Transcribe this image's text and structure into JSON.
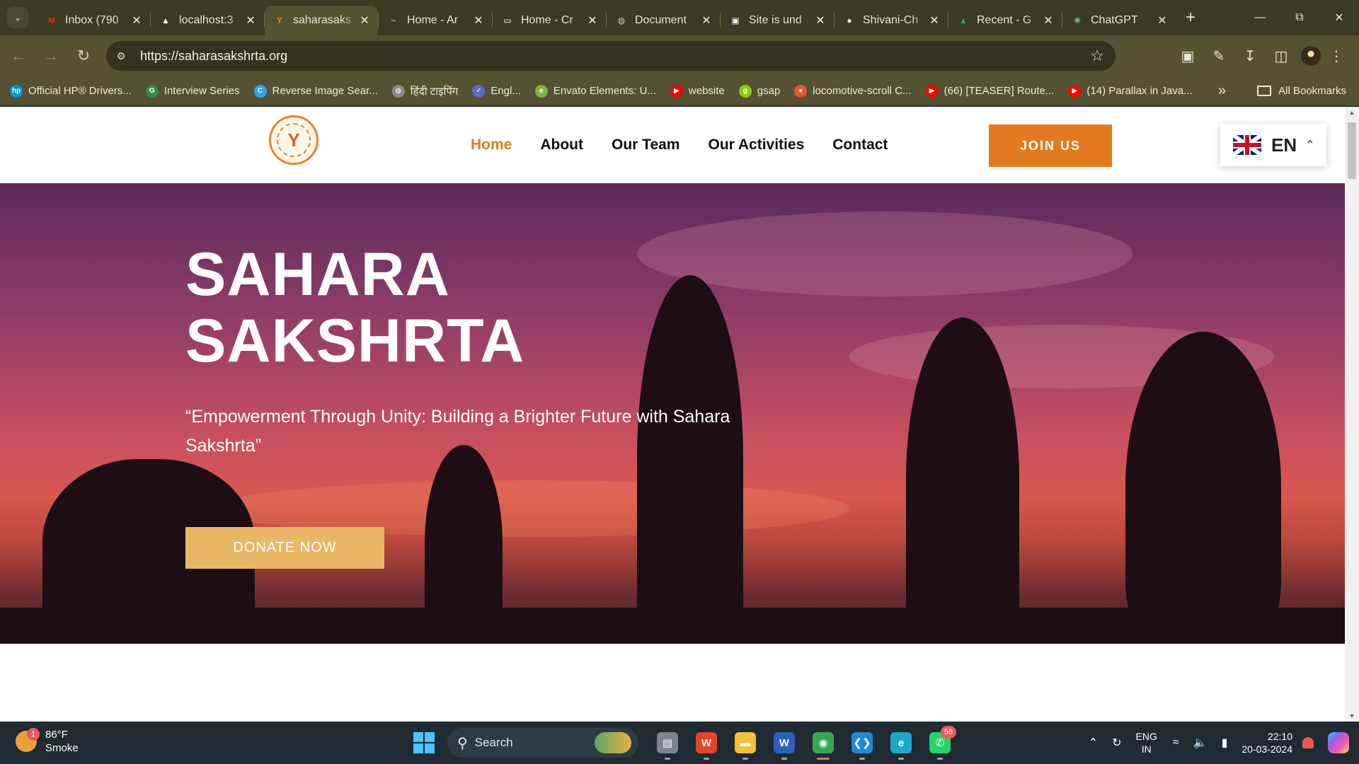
{
  "browser": {
    "tabs": [
      {
        "label": "Inbox (790",
        "icon": "gmail-icon",
        "color": "#d93025",
        "glyph": "M",
        "active": false
      },
      {
        "label": "localhost:3",
        "icon": "vercel-icon",
        "color": "#ffffff",
        "glyph": "▲",
        "active": false
      },
      {
        "label": "saharasaks",
        "icon": "sahara-logo-icon",
        "color": "#e8842a",
        "glyph": "Y",
        "active": true
      },
      {
        "label": "Home - Ar",
        "icon": "site-icon",
        "color": "#bdb9a6",
        "glyph": "~",
        "active": false
      },
      {
        "label": "Home - Cr",
        "icon": "doc-icon",
        "color": "#ffffff",
        "glyph": "▭",
        "active": false
      },
      {
        "label": "Document",
        "icon": "globe-icon",
        "color": "#c9c7b7",
        "glyph": "◍",
        "active": false
      },
      {
        "label": "Site is und",
        "icon": "page-icon",
        "color": "#ffffff",
        "glyph": "▣",
        "active": false
      },
      {
        "label": "Shivani-Ch",
        "icon": "github-icon",
        "color": "#ffffff",
        "glyph": "●",
        "active": false
      },
      {
        "label": "Recent - G",
        "icon": "google-drive-icon",
        "color": "#34a853",
        "glyph": "▲",
        "active": false
      },
      {
        "label": "ChatGPT",
        "icon": "chatgpt-icon",
        "color": "#74aa9c",
        "glyph": "✺",
        "active": false
      }
    ],
    "url": "https://saharasakshrta.org",
    "bookmarks": [
      {
        "label": "Official HP® Drivers...",
        "icon": "hp-icon",
        "color": "#0096d6",
        "glyph": "hp"
      },
      {
        "label": "Interview Series",
        "icon": "gfg-icon",
        "color": "#2f8d46",
        "glyph": "G"
      },
      {
        "label": "Reverse Image Sear...",
        "icon": "reverse-image-icon",
        "color": "#2ea3f2",
        "glyph": "C"
      },
      {
        "label": "हिंदी टाइपिंग",
        "icon": "hindi-typing-icon",
        "color": "#8a8a8a",
        "glyph": "◍"
      },
      {
        "label": "Engl...",
        "icon": "check-icon",
        "color": "#5c6bc0",
        "glyph": "✓"
      },
      {
        "label": "Envato Elements: U...",
        "icon": "envato-icon",
        "color": "#82b541",
        "glyph": "e"
      },
      {
        "label": "website",
        "icon": "youtube-icon",
        "color": "#ff0000",
        "glyph": "▶"
      },
      {
        "label": "gsap",
        "icon": "gsap-icon",
        "color": "#88ce02",
        "glyph": "g"
      },
      {
        "label": "locomotive-scroll C...",
        "icon": "locomotive-icon",
        "color": "#e4572e",
        "glyph": "●"
      },
      {
        "label": "(66) [TEASER] Route...",
        "icon": "youtube-icon",
        "color": "#ff0000",
        "glyph": "▶"
      },
      {
        "label": "(14) Parallax in Java...",
        "icon": "youtube-icon",
        "color": "#ff0000",
        "glyph": "▶"
      }
    ],
    "all_bookmarks_label": "All Bookmarks"
  },
  "site": {
    "nav": [
      "Home",
      "About",
      "Our Team",
      "Our Activities",
      "Contact"
    ],
    "join_label": "JOIN US",
    "language": "EN",
    "hero": {
      "title_line1": "SAHARA",
      "title_line2": "SAKSHRTA",
      "subtitle": "“Empowerment Through Unity: Building a Brighter Future with Sahara Sakshrta”",
      "donate_label": "DONATE NOW"
    },
    "colors": {
      "accent": "#e47a20",
      "donate": "#e7b765",
      "nav_active": "#e07a22"
    }
  },
  "taskbar": {
    "weather": {
      "temp": "86°F",
      "condition": "Smoke",
      "badge": "1"
    },
    "search_label": "Search",
    "apps": [
      {
        "name": "file-stack-icon",
        "color": "#7a8590",
        "glyph": "▤"
      },
      {
        "name": "wps-office-icon",
        "color": "#e8412c",
        "glyph": "W"
      },
      {
        "name": "file-explorer-icon",
        "color": "#f3c13a",
        "glyph": "▬"
      },
      {
        "name": "word-icon",
        "color": "#2b5fb9",
        "glyph": "W"
      },
      {
        "name": "chrome-icon",
        "color": "#34a853",
        "glyph": "◉",
        "active": true
      },
      {
        "name": "vscode-icon",
        "color": "#1f8ad2",
        "glyph": "❮❯"
      },
      {
        "name": "edge-icon",
        "color": "#1fa7c9",
        "glyph": "e"
      },
      {
        "name": "whatsapp-icon",
        "color": "#25d366",
        "glyph": "✆",
        "badge": "58"
      }
    ],
    "lang_line1": "ENG",
    "lang_line2": "IN",
    "time": "22:10",
    "date": "20-03-2024"
  }
}
